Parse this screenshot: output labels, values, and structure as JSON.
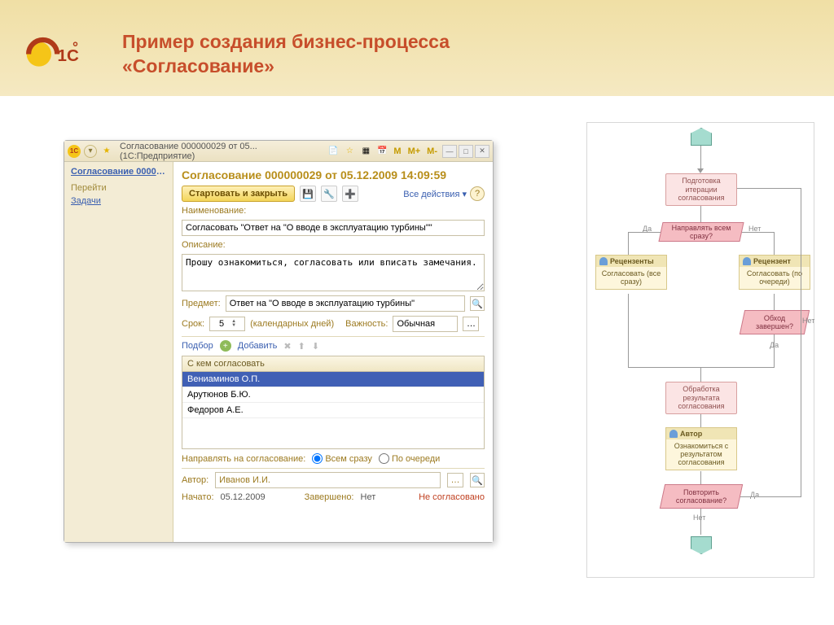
{
  "slide": {
    "title_line1": "Пример создания бизнес-процесса",
    "title_line2": "«Согласование»"
  },
  "titlebar": {
    "text": "Согласование 000000029 от 05...   (1С:Предприятие)",
    "m": "M",
    "mplus": "M+",
    "mminus": "M-"
  },
  "nav": {
    "current": "Согласование 000000...",
    "section": "Перейти",
    "link_tasks": "Задачи"
  },
  "form": {
    "title": "Согласование 000000029 от 05.12.2009 14:09:59",
    "btn_start": "Стартовать и закрыть",
    "all_actions": "Все действия ▾",
    "lbl_name": "Наименование:",
    "val_name": "Согласовать \"Ответ на \"О вводе в эксплуатацию турбины\"\"",
    "lbl_desc": "Описание:",
    "val_desc": "Прошу ознакомиться, согласовать или вписать замечания.",
    "lbl_subject": "Предмет:",
    "val_subject": "Ответ на \"О вводе в эксплуатацию турбины\"",
    "lbl_deadline": "Срок:",
    "val_deadline": "5",
    "deadline_unit": "(календарных дней)",
    "lbl_priority": "Важность:",
    "val_priority": "Обычная",
    "tt_select": "Подбор",
    "tt_add": "Добавить",
    "grid_header": "С кем согласовать",
    "people": [
      "Вениаминов О.П.",
      "Арутюнов Б.Ю.",
      "Федоров А.Е."
    ],
    "lbl_route": "Направлять на согласование:",
    "opt_all": "Всем сразу",
    "opt_seq": "По очереди",
    "lbl_author": "Автор:",
    "val_author": "Иванов И.И.",
    "lbl_started": "Начато:",
    "val_started": "05.12.2009",
    "lbl_finished": "Завершено:",
    "val_finished": "Нет",
    "status": "Не согласовано"
  },
  "flow": {
    "prep": "Подготовка итерации согласования",
    "q_all": "Направлять всем сразу?",
    "yes": "Да",
    "no": "Нет",
    "reviewers": "Рецензенты",
    "rev_all": "Согласовать (все сразу)",
    "reviewer": "Рецензент",
    "rev_seq": "Согласовать (по очереди)",
    "q_done": "Обход завершен?",
    "process": "Обработка результата согласования",
    "author": "Автор",
    "acquaint": "Ознакомиться с результатом согласования",
    "q_repeat": "Повторить согласование?"
  }
}
